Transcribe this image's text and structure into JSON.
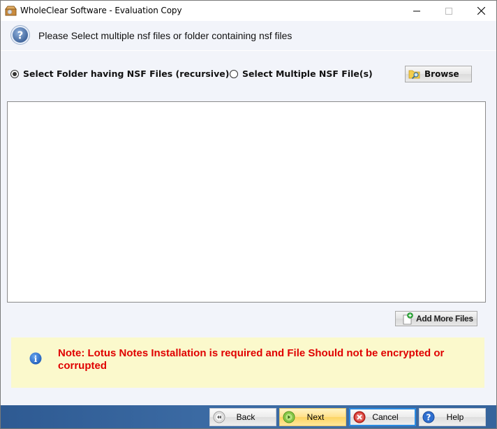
{
  "window": {
    "title": "WholeClear Software - Evaluation Copy",
    "app_icon": "box-package-icon",
    "controls": {
      "minimize": "minimize-icon",
      "maximize": "maximize-icon",
      "close": "close-icon"
    }
  },
  "header": {
    "icon": "question-icon",
    "text": "Please Select multiple nsf files or folder containing nsf files"
  },
  "selection": {
    "options": [
      {
        "label": "Select Folder having NSF Files (recursive)",
        "checked": true
      },
      {
        "label": "Select Multiple NSF File(s)",
        "checked": false
      }
    ],
    "browse_label": "Browse",
    "browse_icon": "folder-search-icon"
  },
  "file_list": {
    "items": []
  },
  "add_more": {
    "label": "Add More Files",
    "icon": "add-file-icon"
  },
  "note": {
    "icon": "info-icon",
    "text": "Note: Lotus Notes Installation is required and File Should not be encrypted or corrupted"
  },
  "footer": {
    "back_label": "Back",
    "next_label": "Next",
    "cancel_label": "Cancel",
    "help_label": "Help"
  },
  "colors": {
    "note_text": "#e00000",
    "note_background": "#fbf9cc",
    "footer_bar": "#3b6aa3",
    "next_button": "#ffe08a",
    "cancel_focus": "#2a8ae0"
  }
}
